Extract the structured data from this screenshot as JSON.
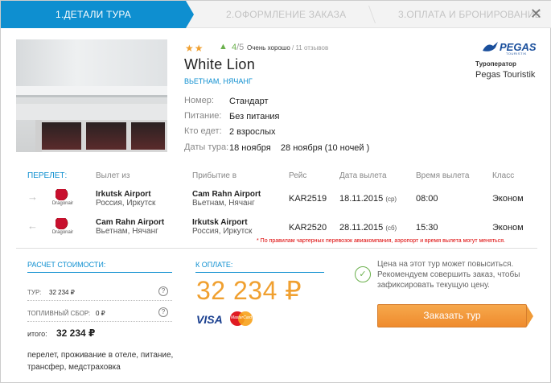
{
  "steps": [
    {
      "label": "1.ДЕТАЛИ ТУРА"
    },
    {
      "label": "2.ОФОРМЛЕНИЕ ЗАКАЗА"
    },
    {
      "label": "3.ОПЛАТА И БРОНИРОВАНИЕ"
    }
  ],
  "close_label": "✕",
  "hotel": {
    "stars": "★★",
    "score": "4",
    "score_den": "/5",
    "rating_text": "Очень хорошо",
    "reviews": " / 11 отзывов",
    "name": "White Lion",
    "location": "ВЬЕТНАМ, НЯЧАНГ"
  },
  "details": [
    {
      "label": "Номер:",
      "value": "Стандарт"
    },
    {
      "label": "Питание:",
      "value": "Без питания"
    },
    {
      "label": "Кто едет:",
      "value": "2 взрослых"
    },
    {
      "label": "Даты тура:",
      "value": "18 ноября    28 ноября (10 ночей )"
    }
  ],
  "operator": {
    "logo_text": "PEGAS",
    "logo_sub": "TOURISTIK",
    "label": "Туроператор",
    "name": "Pegas Touristik"
  },
  "flights": {
    "headers": {
      "section": "ПЕРЕЛЕТ:",
      "from": "Вылет из",
      "to": "Прибытие в",
      "flight": "Рейс",
      "date": "Дата вылета",
      "time": "Время вылета",
      "class": "Класс"
    },
    "rows": [
      {
        "airline": "Dragonair",
        "from_airport": "Irkutsk Airport",
        "from_loc": "Россия, Иркутск",
        "to_airport": "Cam Rahn Airport",
        "to_loc": "Вьетнам, Нячанг",
        "flight": "KAR2519",
        "date": "18.11.2015",
        "day": "(ср)",
        "time": "08:00",
        "class": "Эконом"
      },
      {
        "airline": "Dragonair",
        "from_airport": "Cam Rahn Airport",
        "from_loc": "Вьетнам, Нячанг",
        "to_airport": "Irkutsk Airport",
        "to_loc": "Россия, Иркутск",
        "flight": "KAR2520",
        "date": "28.11.2015",
        "day": "(сб)",
        "time": "15:30",
        "class": "Эконом"
      }
    ],
    "note": "* По правилам чартерных перевозок авиакомпания, аэропорт и время вылета могут меняться."
  },
  "calc": {
    "title": "РАСЧЕТ СТОИМОСТИ:",
    "tour_label": "ТУР:",
    "tour_value": "32 234 ₽",
    "fuel_label": "ТОПЛИВНЫЙ СБОР:",
    "fuel_value": "0 ₽",
    "total_label": "итого:",
    "total_value": "32 234 ₽",
    "includes": "перелет, проживание в отеле, питание, трансфер, медстраховка"
  },
  "payment": {
    "title": "К ОПЛАТЕ:",
    "price": "32 234 ₽",
    "visa": "VISA",
    "mastercard": "MasterCard"
  },
  "notice": {
    "text": "Цена на этот тур может повыситься. Рекомендуем совершить заказ, чтобы зафиксировать текущую цену."
  },
  "order_button": "Заказать тур"
}
